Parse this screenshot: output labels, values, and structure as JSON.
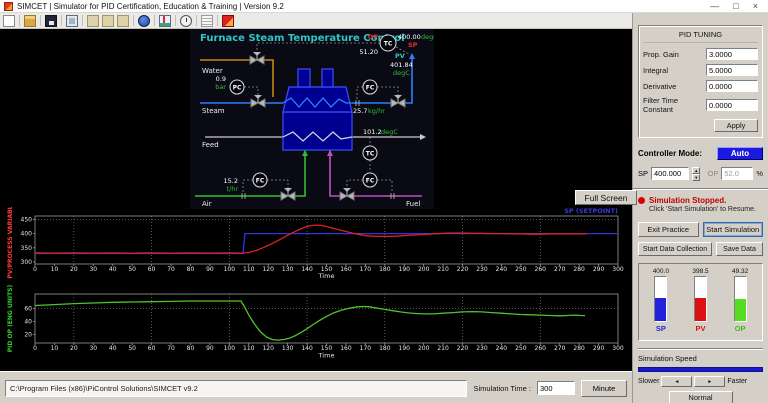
{
  "window": {
    "title": "SIMCET | Simulator for PID Certification, Education & Training | Version 9.2",
    "controls": {
      "minimize": "—",
      "maximize": "□",
      "close": "×"
    }
  },
  "toolbar": {
    "icons": [
      "new",
      "open",
      "save",
      "monitor",
      "report-1",
      "report-2",
      "report-3",
      "help",
      "trend",
      "timer",
      "notes",
      "app-exit"
    ]
  },
  "diagram": {
    "title": "Furnace Steam Temperature Control",
    "labels": {
      "water": "Water",
      "steam": "Steam",
      "feed": "Feed",
      "air": "Air",
      "fuel": "Fuel"
    },
    "instruments": {
      "tc_top": "TC",
      "pc": "PC",
      "fc_steam": "FC",
      "tc_mid": "TC",
      "fc_fuel": "FC",
      "fc_air": "FC"
    },
    "values": {
      "op_label": "OP",
      "op_value": "51.20",
      "sp_value": "400.00",
      "sp_unit": "degC",
      "sp_label": "SP",
      "pv_label": "PV",
      "pv_value": "401.84",
      "pv_unit": "degC",
      "pressure_value": "0.9",
      "pressure_unit": "bar",
      "steam_flow_value": "25.7",
      "steam_flow_unit": "kg/hr",
      "feed_temp_value": "101.2",
      "feed_temp_unit": "degC",
      "air_flow_value": "15.2",
      "air_flow_unit": "t/hr"
    },
    "fullscreen_button": "Full Screen"
  },
  "chart_data": [
    {
      "type": "line",
      "ylabel": "PV/PROCESS VARIABLE",
      "ylabel_color": "#ff3a3a",
      "xlabel": "Time",
      "xlim": [
        0,
        300
      ],
      "ylim": [
        293,
        462
      ],
      "yticks": [
        300,
        350,
        400,
        450
      ],
      "xticks": [
        0,
        10,
        20,
        30,
        40,
        50,
        60,
        70,
        80,
        90,
        100,
        110,
        120,
        130,
        140,
        150,
        160,
        170,
        180,
        190,
        200,
        210,
        220,
        230,
        240,
        250,
        260,
        270,
        280,
        290,
        300
      ],
      "grid_x": [
        20,
        60,
        100,
        140,
        180,
        220,
        260
      ],
      "grid_y": [
        450
      ],
      "legend_text": "SP (SETPOINT)",
      "legend_color": "#3a3adf",
      "series": [
        {
          "name": "SP (SETPOINT)",
          "color": "#3333dd",
          "points": [
            [
              0,
              330
            ],
            [
              107,
              330
            ],
            [
              108,
              400
            ],
            [
              300,
              400
            ]
          ]
        },
        {
          "name": "PV",
          "color": "#dd2222",
          "points": [
            [
              0,
              332
            ],
            [
              10,
              331
            ],
            [
              20,
              332
            ],
            [
              30,
              331
            ],
            [
              40,
              332
            ],
            [
              50,
              331
            ],
            [
              60,
              332
            ],
            [
              70,
              331
            ],
            [
              80,
              332
            ],
            [
              90,
              331
            ],
            [
              100,
              332
            ],
            [
              106,
              331
            ],
            [
              110,
              333
            ],
            [
              114,
              341
            ],
            [
              118,
              352
            ],
            [
              122,
              365
            ],
            [
              126,
              379
            ],
            [
              130,
              394
            ],
            [
              134,
              408
            ],
            [
              138,
              420
            ],
            [
              141,
              427
            ],
            [
              144,
              430
            ],
            [
              147,
              429
            ],
            [
              150,
              425
            ],
            [
              154,
              418
            ],
            [
              158,
              411
            ],
            [
              162,
              404
            ],
            [
              166,
              398
            ],
            [
              170,
              393
            ],
            [
              174,
              391
            ],
            [
              178,
              390
            ],
            [
              182,
              390
            ],
            [
              186,
              391
            ],
            [
              190,
              393
            ],
            [
              195,
              395
            ],
            [
              200,
              397
            ],
            [
              205,
              399
            ],
            [
              210,
              401
            ],
            [
              215,
              402
            ],
            [
              220,
              402
            ],
            [
              225,
              401
            ],
            [
              230,
              401
            ],
            [
              235,
              400
            ],
            [
              240,
              400
            ],
            [
              245,
              399
            ],
            [
              250,
              399
            ],
            [
              255,
              398
            ],
            [
              260,
              398
            ],
            [
              265,
              399
            ],
            [
              270,
              399
            ],
            [
              275,
              399
            ],
            [
              280,
              399
            ],
            [
              284,
              399
            ]
          ]
        }
      ]
    },
    {
      "type": "line",
      "ylabel": "PID OP (ENG UNITS)",
      "ylabel_color": "#35cc35",
      "xlabel": "Time",
      "xlim": [
        0,
        300
      ],
      "ylim": [
        6.5,
        83
      ],
      "yticks": [
        20,
        40,
        60
      ],
      "xticks": [
        0,
        10,
        20,
        30,
        40,
        50,
        60,
        70,
        80,
        90,
        100,
        110,
        120,
        130,
        140,
        150,
        160,
        170,
        180,
        190,
        200,
        210,
        220,
        230,
        240,
        250,
        260,
        270,
        280,
        290,
        300
      ],
      "grid_x": [
        20,
        60,
        100,
        140,
        180,
        220,
        260
      ],
      "grid_y": [
        60
      ],
      "series": [
        {
          "name": "OP",
          "color": "#4fc32f",
          "points": [
            [
              0,
              65
            ],
            [
              10,
              66.5
            ],
            [
              20,
              68
            ],
            [
              30,
              69
            ],
            [
              40,
              70
            ],
            [
              50,
              70.5
            ],
            [
              60,
              71
            ],
            [
              70,
              71.5
            ],
            [
              80,
              72
            ],
            [
              90,
              72
            ],
            [
              100,
              72
            ],
            [
              106,
              72
            ],
            [
              108,
              62
            ],
            [
              110,
              50
            ],
            [
              113,
              36
            ],
            [
              116,
              24
            ],
            [
              119,
              16
            ],
            [
              122,
              12
            ],
            [
              125,
              11
            ],
            [
              128,
              12
            ],
            [
              131,
              14
            ],
            [
              134,
              18
            ],
            [
              138,
              25
            ],
            [
              142,
              33
            ],
            [
              146,
              41
            ],
            [
              150,
              48
            ],
            [
              154,
              54
            ],
            [
              158,
              58
            ],
            [
              162,
              61
            ],
            [
              166,
              63
            ],
            [
              169,
              63.5
            ],
            [
              172,
              63
            ],
            [
              176,
              61
            ],
            [
              180,
              59
            ],
            [
              184,
              57
            ],
            [
              188,
              55
            ],
            [
              192,
              53.5
            ],
            [
              196,
              52.5
            ],
            [
              200,
              52
            ],
            [
              205,
              52
            ],
            [
              210,
              53
            ],
            [
              215,
              54
            ],
            [
              220,
              55
            ],
            [
              225,
              55.5
            ],
            [
              230,
              55
            ],
            [
              235,
              54
            ],
            [
              240,
              53
            ],
            [
              245,
              52
            ],
            [
              250,
              51
            ],
            [
              255,
              50.5
            ],
            [
              260,
              50
            ],
            [
              265,
              49.5
            ],
            [
              270,
              49
            ],
            [
              274,
              49.5
            ],
            [
              278,
              50
            ],
            [
              281,
              49.5
            ],
            [
              283,
              49.3
            ]
          ]
        }
      ]
    }
  ],
  "pid_panel": {
    "title": "PID TUNING",
    "fields": [
      {
        "label": "Prop. Gain",
        "value": "3.0000"
      },
      {
        "label": "Integral",
        "value": "5.0000"
      },
      {
        "label": "Derivative",
        "value": "0.0000"
      },
      {
        "label": "Filter Time Constant",
        "value": "0.0000"
      }
    ],
    "apply_label": "Apply"
  },
  "controller": {
    "mode_label": "Controller Mode:",
    "mode_value": "Auto",
    "sp_label": "SP",
    "sp_value": "400.000",
    "op_label": "OP",
    "op_value": "52.0",
    "op_unit": "%"
  },
  "status": {
    "title": "Simulation Stopped.",
    "subtitle": "Click 'Start Simulation' to Resume."
  },
  "actions": {
    "exit": "Exit Practice",
    "start": "Start Simulation",
    "collect": "Start Data Collection",
    "save": "Save Data"
  },
  "indicators": [
    {
      "label": "SP",
      "value": "400.0",
      "color": "#2222dd",
      "label_color": "#2222dd",
      "fill_pct": 52
    },
    {
      "label": "PV",
      "value": "398.5",
      "color": "#dd1111",
      "label_color": "#dd1111",
      "fill_pct": 52
    },
    {
      "label": "OP",
      "value": "49.32",
      "color": "#55dd22",
      "label_color": "#44bb11",
      "fill_pct": 50
    }
  ],
  "speed": {
    "title": "Simulation Speed",
    "slower": "Slower",
    "faster": "Faster",
    "normal": "Normal",
    "left_arrow": "◄",
    "right_arrow": "►"
  },
  "statusbar": {
    "path": "C:\\Program Files (x86)\\PiControl Solutions\\SIMCET v9.2",
    "sim_time_label": "Simulation Time :",
    "sim_time_value": "300",
    "unit_button": "Minute"
  }
}
